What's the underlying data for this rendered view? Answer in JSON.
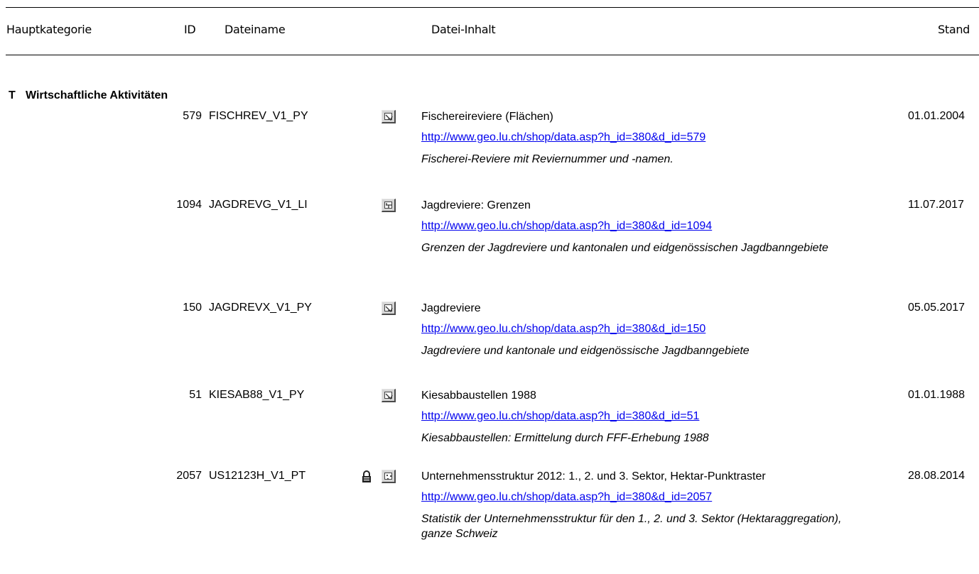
{
  "header": {
    "hauptkategorie": "Hauptkategorie",
    "id": "ID",
    "dateiname": "Dateiname",
    "inhalt": "Datei-Inhalt",
    "stand": "Stand"
  },
  "category": {
    "letter": "T",
    "name": "Wirtschaftliche Aktivitäten"
  },
  "rows": [
    {
      "id": "579",
      "filename": "FISCHREV_V1_PY",
      "geometry_icon": "polygon-icon",
      "locked": false,
      "title": "Fischereireviere (Flächen)",
      "link": "http://www.geo.lu.ch/shop/data.asp?h_id=380&d_id=579",
      "description": "Fischerei-Reviere mit Reviernummer und -namen.",
      "stand": "01.01.2004"
    },
    {
      "id": "1094",
      "filename": "JAGDREVG_V1_LI",
      "geometry_icon": "line-icon",
      "locked": false,
      "title": "Jagdreviere: Grenzen",
      "link": "http://www.geo.lu.ch/shop/data.asp?h_id=380&d_id=1094",
      "description": "Grenzen der Jagdreviere und kantonalen und eidgenössischen Jagdbanngebiete",
      "stand": "11.07.2017"
    },
    {
      "id": "150",
      "filename": "JAGDREVX_V1_PY",
      "geometry_icon": "polygon-icon",
      "locked": false,
      "title": "Jagdreviere",
      "link": "http://www.geo.lu.ch/shop/data.asp?h_id=380&d_id=150",
      "description": "Jagdreviere und kantonale und eidgenössische Jagdbanngebiete",
      "stand": "05.05.2017"
    },
    {
      "id": "51",
      "filename": "KIESAB88_V1_PY",
      "geometry_icon": "polygon-icon",
      "locked": false,
      "title": "Kiesabbaustellen 1988",
      "link": "http://www.geo.lu.ch/shop/data.asp?h_id=380&d_id=51",
      "description": "Kiesabbaustellen: Ermittelung durch FFF-Erhebung 1988",
      "stand": "01.01.1988"
    },
    {
      "id": "2057",
      "filename": "US12123H_V1_PT",
      "geometry_icon": "point-icon",
      "locked": true,
      "title": "Unternehmensstruktur 2012: 1., 2. und 3. Sektor, Hektar-Punktraster",
      "link": "http://www.geo.lu.ch/shop/data.asp?h_id=380&d_id=2057",
      "description": "Statistik der Unternehmensstruktur für den 1., 2. und 3. Sektor (Hektaraggregation), ganze Schweiz",
      "stand": "28.08.2014"
    }
  ]
}
